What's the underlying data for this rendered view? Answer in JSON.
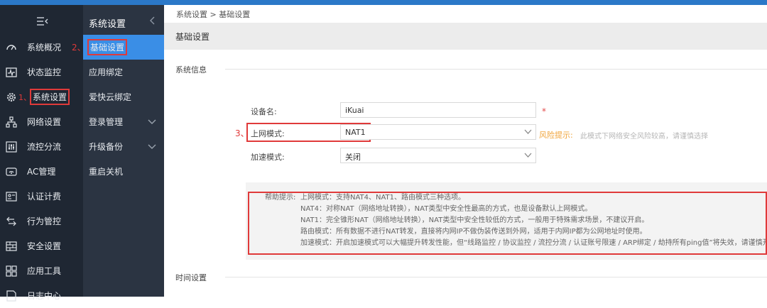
{
  "sidebar": {
    "items": [
      {
        "label": "系统概况",
        "icon": "speedometer-icon"
      },
      {
        "label": "状态监控",
        "icon": "pulse-monitor-icon"
      },
      {
        "label": "系统设置",
        "icon": "gear-icon"
      },
      {
        "label": "网络设置",
        "icon": "network-icon"
      },
      {
        "label": "流控分流",
        "icon": "sliders-icon"
      },
      {
        "label": "AC管理",
        "icon": "wifi-ap-icon"
      },
      {
        "label": "认证计费",
        "icon": "id-card-icon"
      },
      {
        "label": "行为管控",
        "icon": "arrows-icon"
      },
      {
        "label": "安全设置",
        "icon": "firewall-icon"
      },
      {
        "label": "应用工具",
        "icon": "apps-icon"
      },
      {
        "label": "日志中心",
        "icon": "log-icon"
      }
    ]
  },
  "subnav": {
    "title": "系统设置",
    "items": [
      {
        "label": "基础设置"
      },
      {
        "label": "应用绑定"
      },
      {
        "label": "爱快云绑定"
      },
      {
        "label": "登录管理"
      },
      {
        "label": "升级备份"
      },
      {
        "label": "重启关机"
      }
    ]
  },
  "main": {
    "breadcrumb": "系统设置 > 基础设置",
    "panel_title": "基础设置",
    "section_system": "系统信息",
    "section_time": "时间设置",
    "device_label": "设备名:",
    "device_value": "iKuai",
    "required_mark": "*",
    "mode_label": "上网模式:",
    "mode_value": "NAT1",
    "accel_label": "加速模式:",
    "accel_value": "关闭",
    "risk_title": "风险提示:",
    "risk_text": "此模式下网络安全风险较高，请谨慎选择",
    "help_prefix": "帮助提示:",
    "help_lines": [
      "上网模式：支持NAT4、NAT1、路由模式三种选项。",
      "NAT4：对称NAT（网络地址转换），NAT类型中安全性最高的方式，也是设备默认上网模式。",
      "NAT1：完全锥形NAT（网络地址转换），NAT类型中安全性较低的方式，一般用于特殊需求场景，不建议开启。",
      "路由模式：所有数据不进行NAT转发，直接将内网IP不做伪装传送到外网，适用于内网IP都为公网地址时使用。",
      "加速模式：开启加速模式可以大幅提升转发性能，但“线路监控 / 协议监控 / 流控分流 / 认证账号限速 / ARP绑定 / 劫持所有ping值”将失效，请谨慎开启"
    ]
  },
  "annotations": {
    "step1": "1、",
    "step2": "2、",
    "step3": "3、"
  },
  "colors": {
    "accent": "#3a8ee6",
    "topbar": "#2b78c8",
    "sidebar": "#1f2733",
    "subnav": "#2b3442",
    "highlight": "#e03a3a",
    "risk": "#f0a43a"
  }
}
